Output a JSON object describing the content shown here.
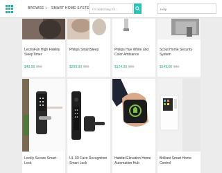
{
  "header": {
    "nav": [
      {
        "label": "BROWSE"
      },
      {
        "label": "SMART HOME SYSTEMS"
      }
    ],
    "search_placeholder": "I'm searching for...",
    "right_field_text": "Help"
  },
  "products_top": [
    {
      "title": "LectroFan High Fidelity SleepTimer",
      "price": "$49.99",
      "was": "$59"
    },
    {
      "title": "Philips SmartSleep",
      "price": "$299.99",
      "was": "$59"
    },
    {
      "title": "Philips Hue White and Color Ambiance",
      "price": "$124.99",
      "was": "$59"
    },
    {
      "title": "Scout Home Security System",
      "price": "$149.00",
      "was": "$59"
    }
  ],
  "products_bottom": [
    {
      "title": "Lockly Secure Smart Lock"
    },
    {
      "title": "UL 3D Face Recognition Smart Lock"
    },
    {
      "title": "Habitat Elevation Home Automation Hub"
    },
    {
      "title": "Brilliant Smart Home Control"
    }
  ],
  "colors": {
    "accent": "#2cc2b6",
    "price": "#2ca98f"
  }
}
